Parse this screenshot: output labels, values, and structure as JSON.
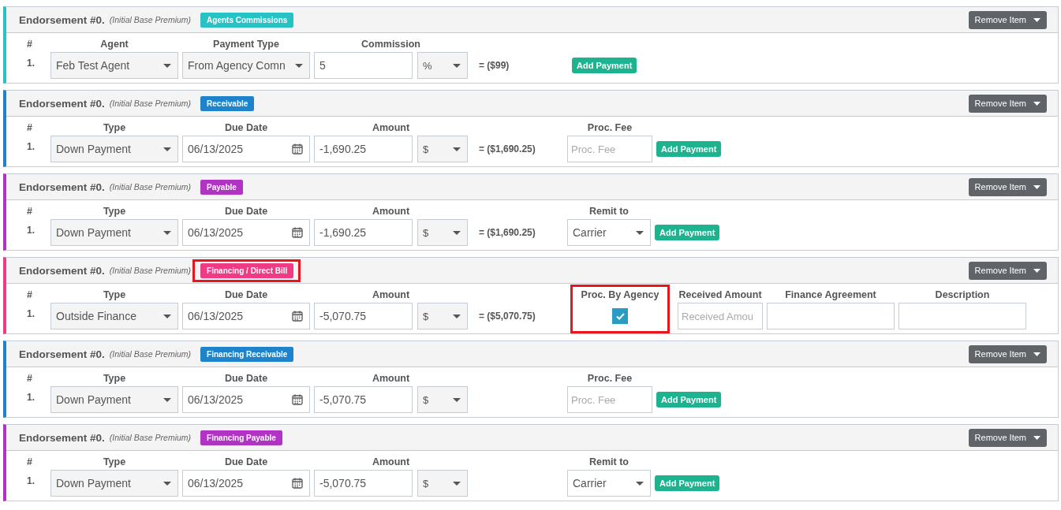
{
  "cards": [
    {
      "title": "Endorsement #0.",
      "subtitle": "(Initial Base Premium)",
      "badge": "Agents Commissions",
      "color": "#26c2c4",
      "highlighted": false,
      "action": "Remove Item",
      "number_header": "#",
      "row_number": "1.",
      "columns": [
        {
          "header": "Agent",
          "fields": [
            {
              "kind": "select",
              "value": "Feb Test Agent"
            }
          ]
        },
        {
          "header": "Payment Type",
          "fields": [
            {
              "kind": "select",
              "value": "From Agency Comn"
            }
          ]
        },
        {
          "header": "Commission",
          "fields": [
            {
              "kind": "text",
              "value": "5"
            },
            {
              "kind": "unit",
              "value": "%"
            }
          ]
        },
        {
          "fields": [
            {
              "kind": "total",
              "text": "= ($99)"
            }
          ]
        },
        {
          "fields": [
            {
              "kind": "spacer"
            },
            {
              "kind": "button",
              "label": "Add Payment"
            }
          ]
        }
      ]
    },
    {
      "title": "Endorsement #0.",
      "subtitle": "(Initial Base Premium)",
      "badge": "Receivable",
      "color": "#1f83cc",
      "highlighted": false,
      "action": "Remove Item",
      "number_header": "#",
      "row_number": "1.",
      "columns": [
        {
          "header": "Type",
          "fields": [
            {
              "kind": "select",
              "value": "Down Payment"
            }
          ]
        },
        {
          "header": "Due Date",
          "fields": [
            {
              "kind": "date",
              "value": "06/13/2025"
            }
          ]
        },
        {
          "header": "Amount",
          "fields": [
            {
              "kind": "text",
              "value": "-1,690.25"
            },
            {
              "kind": "unit",
              "value": "$"
            }
          ]
        },
        {
          "fields": [
            {
              "kind": "total",
              "text": "= ($1,690.25)"
            }
          ]
        },
        {
          "header": "Proc. Fee",
          "fields": [
            {
              "kind": "text",
              "placeholder": "Proc. Fee"
            }
          ]
        },
        {
          "fields": [
            {
              "kind": "button",
              "label": "Add Payment"
            }
          ]
        }
      ]
    },
    {
      "title": "Endorsement #0.",
      "subtitle": "(Initial Base Premium)",
      "badge": "Payable",
      "color": "#b033c4",
      "highlighted": false,
      "action": "Remove Item",
      "number_header": "#",
      "row_number": "1.",
      "columns": [
        {
          "header": "Type",
          "fields": [
            {
              "kind": "select",
              "value": "Down Payment"
            }
          ]
        },
        {
          "header": "Due Date",
          "fields": [
            {
              "kind": "date",
              "value": "06/13/2025"
            }
          ]
        },
        {
          "header": "Amount",
          "fields": [
            {
              "kind": "text",
              "value": "-1,690.25"
            },
            {
              "kind": "unit",
              "value": "$"
            }
          ]
        },
        {
          "fields": [
            {
              "kind": "total",
              "text": "= ($1,690.25)"
            }
          ]
        },
        {
          "header": "Remit to",
          "fields": [
            {
              "kind": "smallselect",
              "value": "Carrier"
            }
          ]
        },
        {
          "fields": [
            {
              "kind": "button",
              "label": "Add Payment"
            }
          ]
        }
      ]
    },
    {
      "title": "Endorsement #0.",
      "subtitle": "(Initial Base Premium)",
      "badge": "Financing / Direct Bill",
      "color": "#ef3a84",
      "highlighted": true,
      "action": "Remove Item",
      "number_header": "#",
      "row_number": "1.",
      "columns": [
        {
          "header": "Type",
          "fields": [
            {
              "kind": "select",
              "value": "Outside Finance"
            }
          ]
        },
        {
          "header": "Due Date",
          "fields": [
            {
              "kind": "date",
              "value": "06/13/2025"
            }
          ]
        },
        {
          "header": "Amount",
          "fields": [
            {
              "kind": "text",
              "value": "-5,070.75"
            },
            {
              "kind": "unit",
              "value": "$"
            }
          ]
        },
        {
          "fields": [
            {
              "kind": "total",
              "text": "= ($5,070.75)"
            }
          ]
        },
        {
          "header": "Proc. By Agency",
          "highlighted": true,
          "fields": [
            {
              "kind": "checkbox",
              "checked": true
            }
          ]
        },
        {
          "header": "Received Amount",
          "fields": [
            {
              "kind": "text",
              "placeholder": "Received Amou"
            }
          ]
        },
        {
          "header": "Finance Agreement",
          "fields": [
            {
              "kind": "wide"
            }
          ]
        },
        {
          "header": "Description",
          "fields": [
            {
              "kind": "wide"
            }
          ]
        }
      ]
    },
    {
      "title": "Endorsement #0.",
      "subtitle": "(Initial Base Premium)",
      "badge": "Financing Receivable",
      "color": "#1f83cc",
      "highlighted": false,
      "action": "Remove Item",
      "number_header": "#",
      "row_number": "1.",
      "columns": [
        {
          "header": "Type",
          "fields": [
            {
              "kind": "select",
              "value": "Down Payment"
            }
          ]
        },
        {
          "header": "Due Date",
          "fields": [
            {
              "kind": "date",
              "value": "06/13/2025"
            }
          ]
        },
        {
          "header": "Amount",
          "fields": [
            {
              "kind": "text",
              "value": "-5,070.75"
            },
            {
              "kind": "unit",
              "value": "$"
            }
          ]
        },
        {
          "fields": [
            {
              "kind": "blank"
            }
          ]
        },
        {
          "header": "Proc. Fee",
          "fields": [
            {
              "kind": "text",
              "placeholder": "Proc. Fee"
            }
          ]
        },
        {
          "fields": [
            {
              "kind": "button",
              "label": "Add Payment"
            }
          ]
        }
      ]
    },
    {
      "title": "Endorsement #0.",
      "subtitle": "(Initial Base Premium)",
      "badge": "Financing Payable",
      "color": "#b033c4",
      "highlighted": false,
      "action": "Remove Item",
      "number_header": "#",
      "row_number": "1.",
      "columns": [
        {
          "header": "Type",
          "fields": [
            {
              "kind": "select",
              "value": "Down Payment"
            }
          ]
        },
        {
          "header": "Due Date",
          "fields": [
            {
              "kind": "date",
              "value": "06/13/2025"
            }
          ]
        },
        {
          "header": "Amount",
          "fields": [
            {
              "kind": "text",
              "value": "-5,070.75"
            },
            {
              "kind": "unit",
              "value": "$"
            }
          ]
        },
        {
          "fields": [
            {
              "kind": "blank"
            }
          ]
        },
        {
          "header": "Remit to",
          "fields": [
            {
              "kind": "smallselect",
              "value": "Carrier"
            }
          ]
        },
        {
          "fields": [
            {
              "kind": "button",
              "label": "Add Payment"
            }
          ]
        }
      ]
    }
  ]
}
